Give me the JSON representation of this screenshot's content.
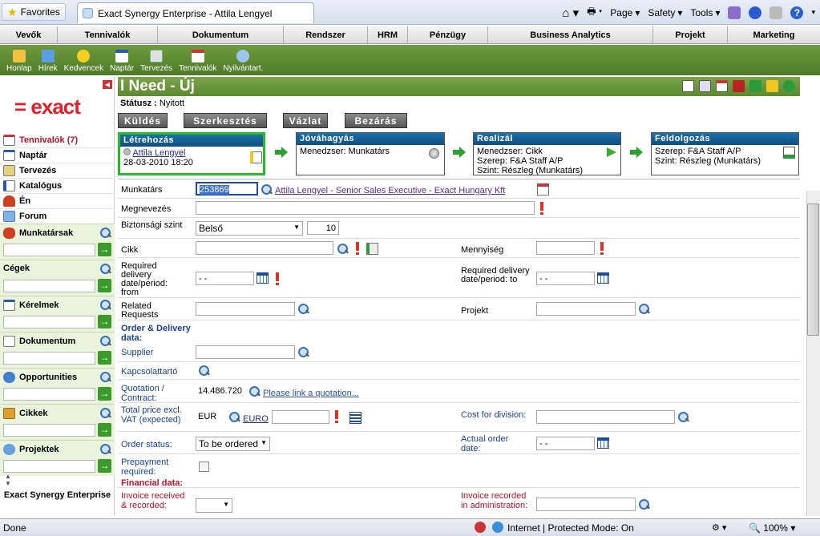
{
  "browser": {
    "favorites_label": "Favorites",
    "tab_title": "Exact Synergy Enterprise - Attila Lengyel",
    "tools": [
      "Page",
      "Safety",
      "Tools"
    ],
    "status_left": "Done",
    "zone": "Internet | Protected Mode: On",
    "zoom": "100%"
  },
  "top_menu": [
    "Vevők",
    "Tennivalók",
    "Dokumentum",
    "Rendszer",
    "HRM",
    "Pénzügy",
    "Business Analytics",
    "Projekt",
    "Marketing"
  ],
  "quick_bar": [
    "Honlap",
    "Hírek",
    "Kedvencek",
    "Naptár",
    "Tervezés",
    "Tennivalók",
    "Nyilvántart."
  ],
  "logo_text": "= exact",
  "left_nav": [
    "Tennivalók (7)",
    "Naptár",
    "Tervezés",
    "Katalógus",
    "Én",
    "Forum"
  ],
  "left_sections": [
    "Munkatársak",
    "Cégek",
    "Kérelmek",
    "Dokumentum",
    "Opportunities",
    "Cikkek",
    "Projektek"
  ],
  "left_footer": "Exact Synergy Enterprise",
  "page": {
    "title": "I Need - Új",
    "status_label": "Státusz :",
    "status_value": "Nyitott",
    "buttons": [
      "Küldés",
      "Szerkesztés",
      "Vázlat",
      "Bezárás"
    ]
  },
  "workflow": {
    "created": {
      "title": "Létrehozás",
      "user": "Attila Lengyel",
      "date": "28-03-2010 18:20"
    },
    "approval": {
      "title": "Jóváhagyás",
      "line1": "Menedzser: Munkatárs"
    },
    "realize": {
      "title": "Realizál",
      "line1": "Menedzser: Cikk",
      "line2": "Szerep: F&A Staff A/P",
      "line3": "Szint: Részleg (Munkatárs)"
    },
    "process": {
      "title": "Feldolgozás",
      "line1": "Szerep: F&A Staff A/P",
      "line2": "Szint: Részleg (Munkatárs)"
    }
  },
  "form": {
    "employee_label": "Munkatárs",
    "employee_id": "253869",
    "employee_link": "Attila Lengyel - Senior Sales Executive - Exact Hungary Kft",
    "description_label": "Megnevezés",
    "security_label": "Biztonsági szint",
    "security_value": "Belső",
    "security_level": "10",
    "item_label": "Cikk",
    "quantity_label": "Mennyiség",
    "req_from_label": "Required delivery date/period: from",
    "req_from_value": "- -",
    "req_to_label": "Required delivery date/period: to",
    "req_to_value": "- -",
    "related_label": "Related Requests",
    "project_label": "Projekt",
    "order_section": "Order & Delivery data:",
    "supplier_label": "Supplier",
    "contact_label": "Kapcsolattartó",
    "quotation_label": "Quotation / Contract:",
    "quotation_value": "14.486.720",
    "quotation_link": "Please link a quotation...",
    "total_label": "Total price excl. VAT (expected)",
    "currency": "EUR",
    "currency_link": "EURO",
    "cost_division_label": "Cost for division:",
    "order_status_label": "Order status:",
    "order_status_value": "To be ordered",
    "actual_order_label": "Actual order date:",
    "actual_order_value": "- -",
    "prepayment_label": "Prepayment required:",
    "financial_section": "Financial data:",
    "invoice_recv_label": "Invoice received & recorded:",
    "invoice_admin_label": "Invoice recorded in administration:"
  }
}
